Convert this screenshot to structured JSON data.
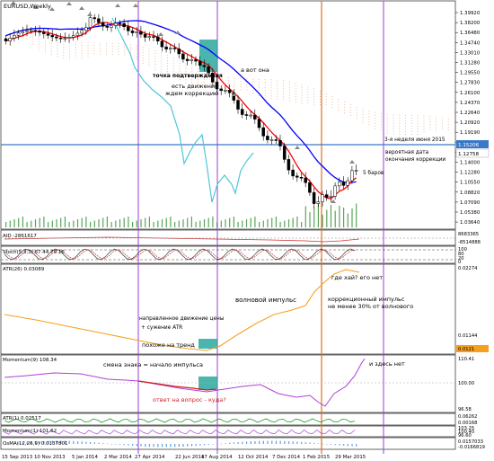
{
  "title": "EURUSD,Weekly",
  "price_axis": [
    "1.39920",
    "1.38200",
    "1.36480",
    "1.34740",
    "1.33010",
    "1.31280",
    "1.29550",
    "1.27830",
    "1.26100",
    "1.24370",
    "1.22640",
    "1.20920",
    "1.19190",
    "1.17460",
    "1.15730",
    "1.14000",
    "1.12280",
    "1.10550",
    "1.08820",
    "1.07090",
    "1.05380",
    "1.03640"
  ],
  "current_price": "1.15206",
  "marked_price": "1.12758",
  "date_axis": [
    "15 Sep 2013",
    "10 Nov 2013",
    "5 Jan 2014",
    "2 Mar 2014",
    "27 Apr 2014",
    "22 Jun 2014",
    "17 Aug 2014",
    "12 Oct 2014",
    "7 Dec 2014",
    "1 Feb 2015",
    "29 Mar 2015"
  ],
  "annotations": {
    "confirm": "точка подтверждения",
    "here_it_is": "а вот она",
    "movement": "есть движение",
    "wait_correction": "ждем коррекцию",
    "week3": "3-я неделя июня 2015",
    "probable1": "вероятная дата",
    "probable2": "окончания коррекции",
    "bars5": "5 баров",
    "where_high": "где хай? его нет",
    "wave_impulse": "волновой импульс",
    "corr_impulse1": "коррекционный импульс",
    "corr_impulse2": "не менее 30% от волнового",
    "directed1": "направленное движение цены",
    "directed2": "+ сужение ATR",
    "like_trend": "похоже на тренд",
    "sign_change": "смена знака = начало импульса",
    "answer": "ответ на вопрос - куда?",
    "not_here": "и здесь нет"
  },
  "panels": {
    "aid": {
      "label": "AID -2861617",
      "axis": [
        "8683365",
        "-8514888"
      ]
    },
    "stoch": {
      "label": "Stoch(5,3,3) 87.44 79.16",
      "axis": [
        "100",
        "80",
        "20",
        "0"
      ]
    },
    "atr26": {
      "label": "ATR(26) 0.03089",
      "axis": [
        "0.02274",
        "0.01144"
      ],
      "tag": "0.0121"
    },
    "momentum9": {
      "label": "Momentum(9) 108.34",
      "axis": [
        "110.41",
        "100.00",
        "96.58"
      ]
    },
    "atr1": {
      "label": "ATR(1) 0.02517",
      "axis": [
        "0.06262",
        "0.00168"
      ]
    },
    "momentum1": {
      "label": "Momentum(1) 101.62",
      "axis": [
        "103.25",
        "100.40",
        "96.60"
      ]
    },
    "osma": {
      "label": "OsMA(12,26,9) 0.0137801",
      "axis": [
        "0.0157033",
        "-0.0166819"
      ]
    }
  },
  "colors": {
    "bg": "#ffffff",
    "bull": "#ffffff",
    "bear": "#000000",
    "ma_blue": "#0000ff",
    "ma_red": "#ff0000",
    "cyan_line": "#4fc6d6",
    "ichimoku": "#e8a880",
    "violet_vline": "#9b3fd6",
    "orange_vline": "#e07020",
    "hline": "#3a78c8",
    "teal_box": "#2aa89e",
    "grid": "#c8c8c8"
  }
}
